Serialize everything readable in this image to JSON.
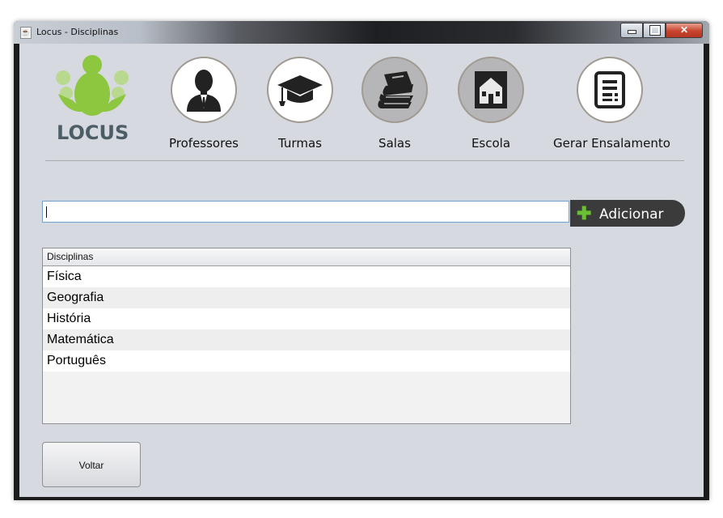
{
  "window": {
    "title": "Locus - Disciplinas"
  },
  "logo": {
    "text": "LOCUS"
  },
  "nav": [
    {
      "label": "Professores",
      "icon": "person-suit-icon",
      "active": false
    },
    {
      "label": "Turmas",
      "icon": "graduation-cap-icon",
      "active": false
    },
    {
      "label": "Salas",
      "icon": "books-icon",
      "active": true
    },
    {
      "label": "Escola",
      "icon": "school-building-icon",
      "active": true
    },
    {
      "label": "Gerar Ensalamento",
      "icon": "document-icon",
      "active": false
    }
  ],
  "form": {
    "input_value": "",
    "add_label": "Adicionar"
  },
  "table": {
    "header": "Disciplinas",
    "rows": [
      "Física",
      "Geografia",
      "História",
      "Matemática",
      "Português"
    ]
  },
  "footer": {
    "back_label": "Voltar"
  },
  "colors": {
    "accent_green": "#8dc63f",
    "add_button": "#3b3b3b",
    "background": "#d6d9e0"
  }
}
